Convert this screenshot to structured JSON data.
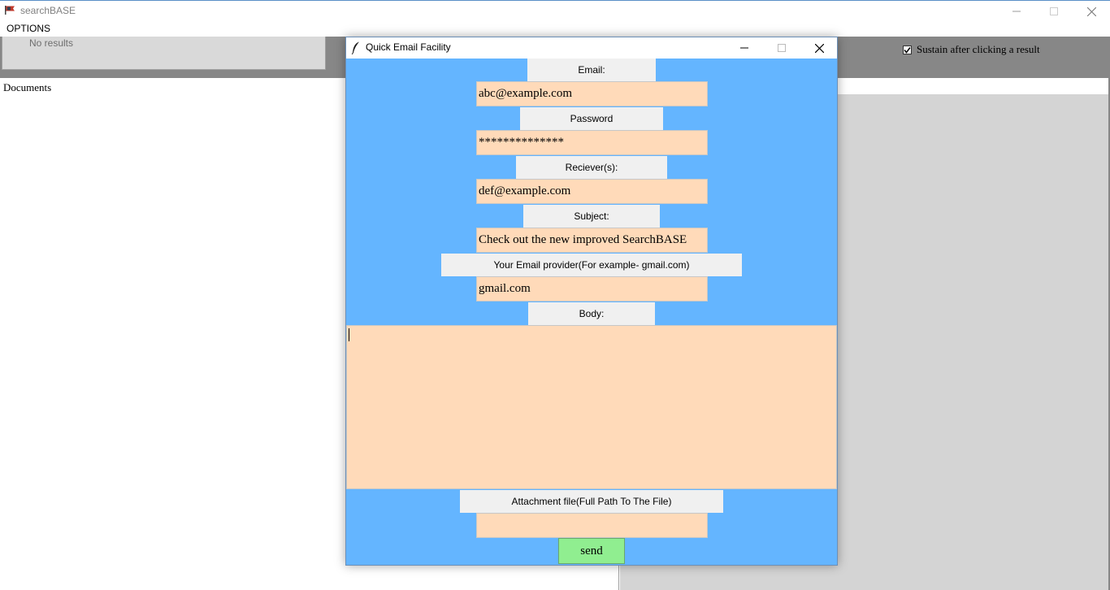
{
  "main_window": {
    "title": "searchBASE",
    "menu_options": "OPTIONS",
    "results_text": "No results",
    "documents_label": "Documents",
    "sustain_label": "Sustain after clicking a result",
    "sustain_checked": true
  },
  "dialog": {
    "title": "Quick Email Facility",
    "email_label": "Email:",
    "email_value": "abc@example.com",
    "password_label": "Password",
    "password_value": "**************",
    "receivers_label": "Reciever(s):",
    "receivers_value": "def@example.com",
    "subject_label": "Subject:",
    "subject_value": "Check out the new improved SearchBASE",
    "provider_label": "Your Email provider(For example-  gmail.com)",
    "provider_value": "gmail.com",
    "body_label": "Body:",
    "body_value": "",
    "attachment_label": "Attachment file(Full Path To The File)",
    "attachment_value": "",
    "send_label": "send"
  },
  "colors": {
    "dialog_background": "#64b5ff",
    "field_background": "#ffdab9",
    "send_button": "#90ee90",
    "label_background": "#f0f0f0"
  }
}
